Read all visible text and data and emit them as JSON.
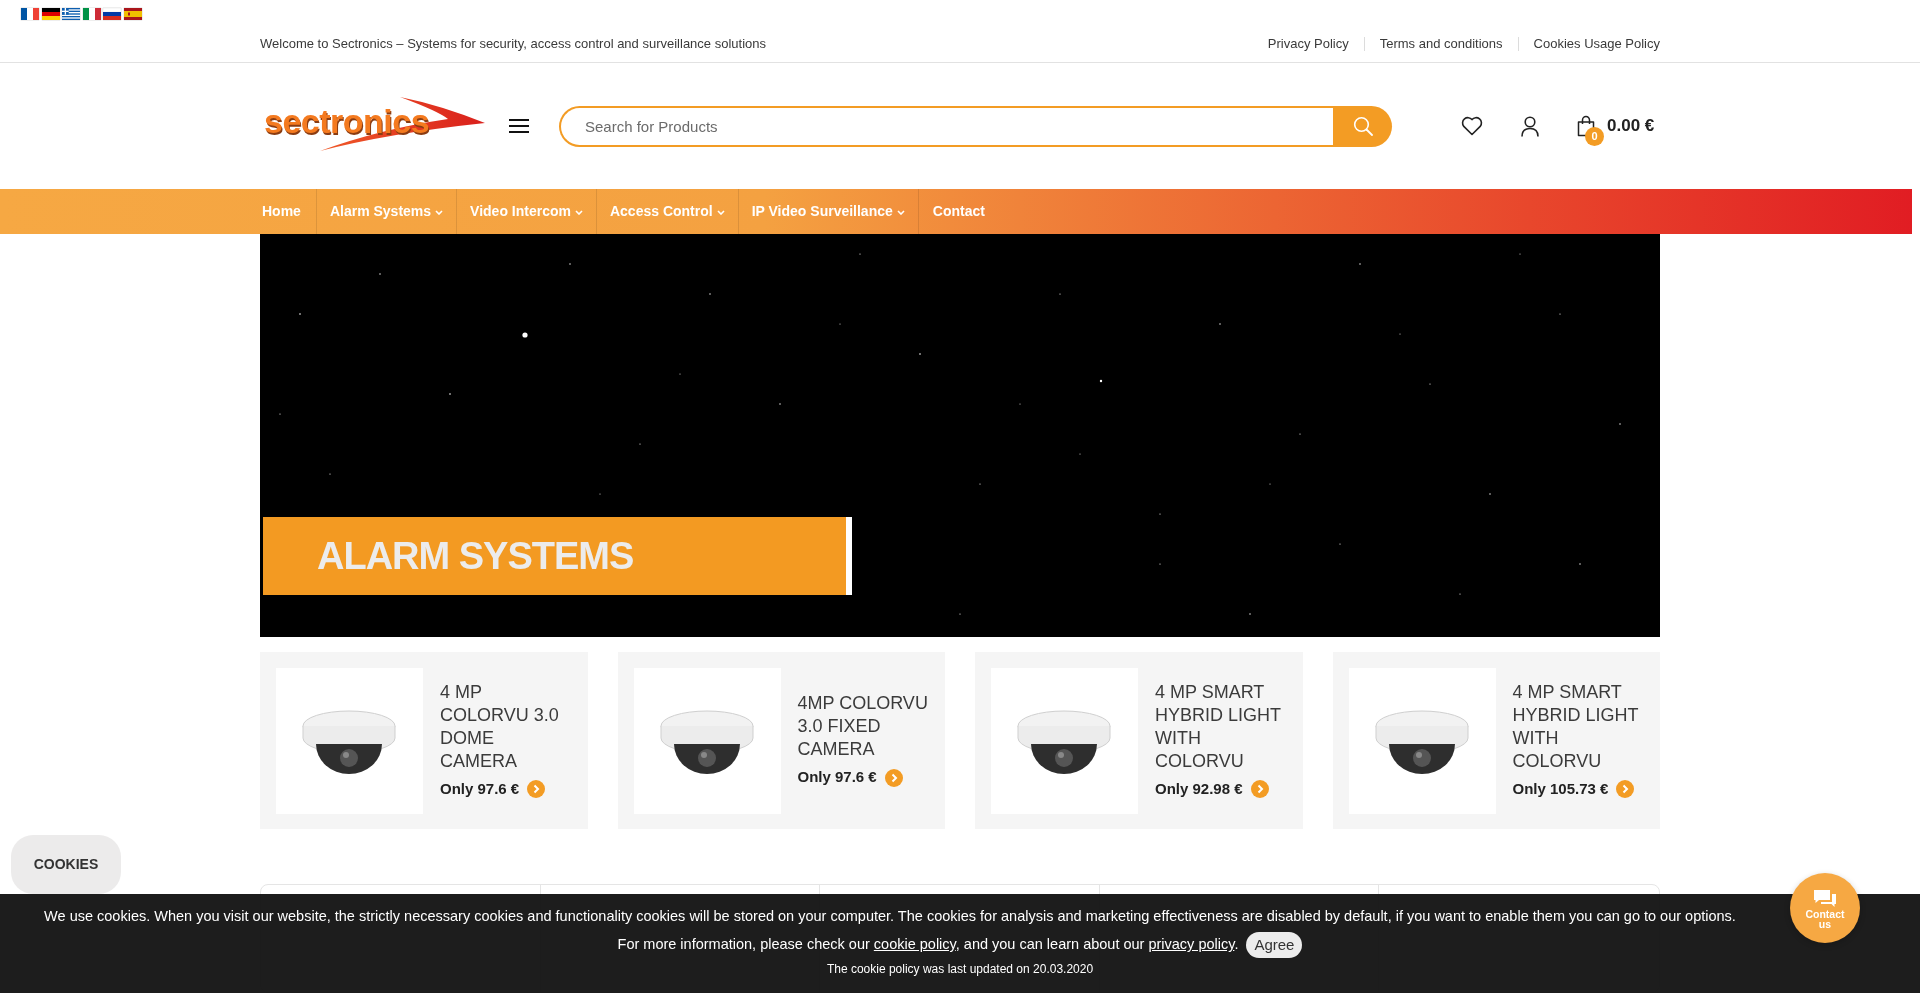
{
  "top_bar": {
    "welcome": "Welcome to Sectronics – Systems for security, access control and surveillance solutions",
    "links": [
      "Privacy Policy",
      "Terms and conditions",
      "Cookies Usage Policy"
    ]
  },
  "header": {
    "logo": "sectronics",
    "search": {
      "placeholder": "Search for Products"
    },
    "cart": {
      "count": "0",
      "total": "0.00 €"
    }
  },
  "nav": [
    {
      "label": "Home",
      "has_submenu": false
    },
    {
      "label": "Alarm Systems",
      "has_submenu": true
    },
    {
      "label": "Video Intercom",
      "has_submenu": true
    },
    {
      "label": "Access Control",
      "has_submenu": true
    },
    {
      "label": "IP Video Surveillance",
      "has_submenu": true
    },
    {
      "label": "Contact",
      "has_submenu": false
    }
  ],
  "hero": {
    "title": "ALARM SYSTEMS"
  },
  "products": [
    {
      "title": "4 MP COLORVU 3.0 DOME CAMERA",
      "price": "Only 97.6 €"
    },
    {
      "title": "4MP COLORVU 3.0 FIXED CAMERA",
      "price": "Only 97.6 €"
    },
    {
      "title": "4 MP SMART HYBRID LIGHT WITH COLORVU",
      "price": "Only 92.98 €"
    },
    {
      "title": "4 MP SMART HYBRID LIGHT WITH COLORVU",
      "price": "Only 105.73 €"
    }
  ],
  "cookies_button": "COOKIES",
  "cookie_banner": {
    "notice": "We use cookies. When you visit our website, the strictly necessary cookies and functionality cookies will be stored on your computer. The cookies for analysis and marketing effectiveness are disabled by default, if you want to enable them you can go to our options.",
    "policy_line": [
      {
        "kind": "text",
        "text": "For more information, please check our "
      },
      {
        "kind": "link",
        "text": "cookie policy"
      },
      {
        "kind": "text",
        "text": ", and you can learn about our "
      },
      {
        "kind": "link",
        "text": "privacy policy"
      },
      {
        "kind": "text",
        "text": "."
      }
    ],
    "agree": "Agree",
    "updated": "The cookie policy was last updated on 20.03.2020"
  },
  "contact_button": "Contact us"
}
